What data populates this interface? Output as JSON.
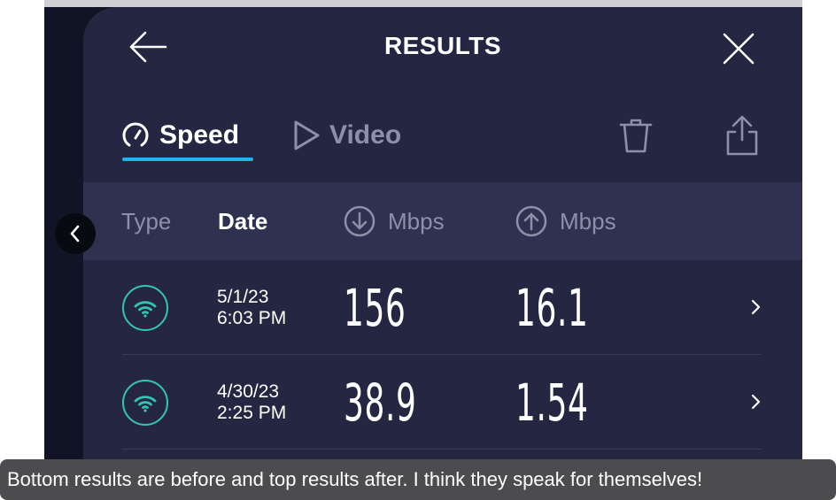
{
  "header": {
    "title": "RESULTS"
  },
  "tabs": [
    {
      "label": "Speed",
      "icon": "speedometer-icon",
      "active": true
    },
    {
      "label": "Video",
      "icon": "play-icon",
      "active": false
    }
  ],
  "toolbar": {
    "delete_icon": "trash-icon",
    "share_icon": "share-icon"
  },
  "columns": {
    "type": "Type",
    "date": "Date",
    "download_unit": "Mbps",
    "download_icon": "download-arrow-icon",
    "upload_unit": "Mbps",
    "upload_icon": "upload-arrow-icon"
  },
  "results": [
    {
      "type_icon": "wifi-icon",
      "date": "5/1/23",
      "time": "6:03 PM",
      "download": "156",
      "upload": "16.1"
    },
    {
      "type_icon": "wifi-icon",
      "date": "4/30/23",
      "time": "2:25 PM",
      "download": "38.9",
      "upload": "1.54"
    }
  ],
  "caption": "Bottom results are before and top results after. I think they speak for themselves!",
  "colors": {
    "accent": "#1fb4ea",
    "wifi": "#35c4b3",
    "panel": "#252742",
    "header_row": "#2e3150",
    "muted": "#8d90a8"
  }
}
